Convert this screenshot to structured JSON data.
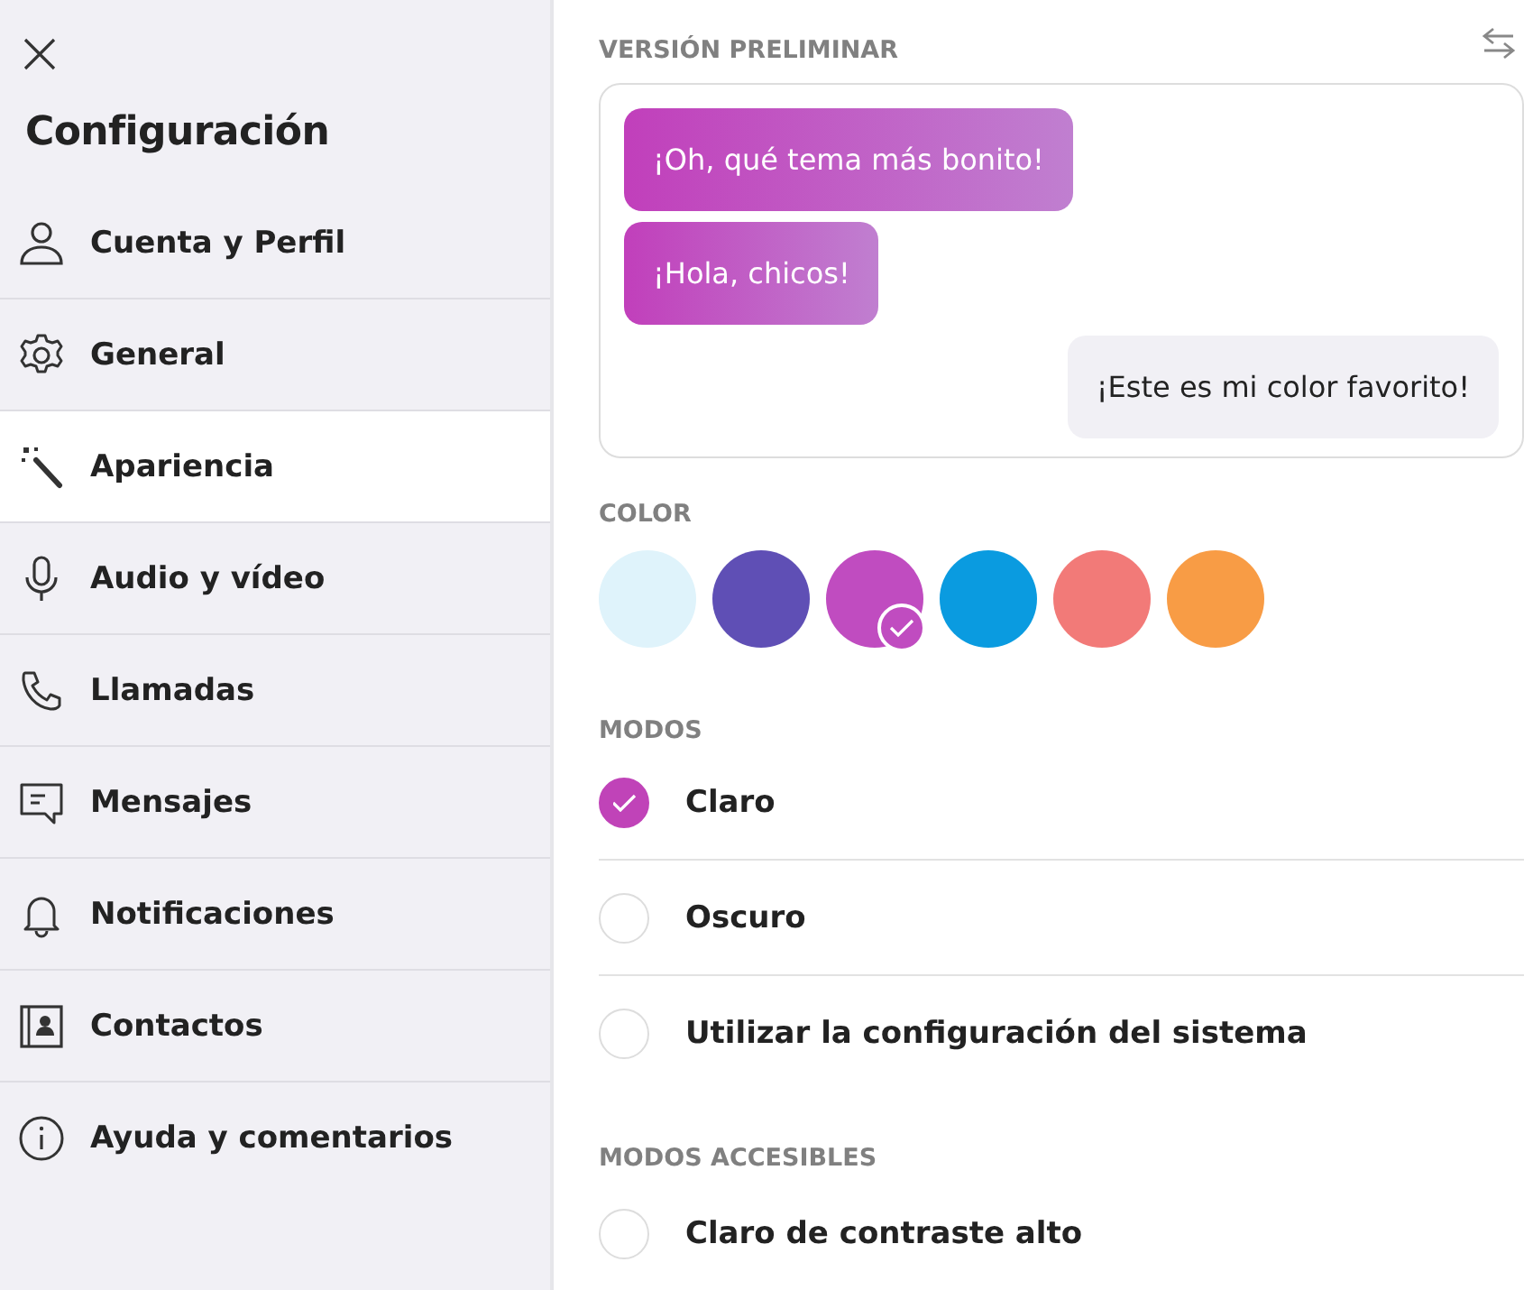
{
  "sidebar": {
    "title": "Configuración",
    "items": [
      {
        "label": "Cuenta y Perfil",
        "selected": false
      },
      {
        "label": "General",
        "selected": false
      },
      {
        "label": "Apariencia",
        "selected": true
      },
      {
        "label": "Audio y vídeo",
        "selected": false
      },
      {
        "label": "Llamadas",
        "selected": false
      },
      {
        "label": "Mensajes",
        "selected": false
      },
      {
        "label": "Notificaciones",
        "selected": false
      },
      {
        "label": "Contactos",
        "selected": false
      },
      {
        "label": "Ayuda y comentarios",
        "selected": false
      }
    ]
  },
  "preview": {
    "heading": "VERSIÓN PRELIMINAR",
    "messages": [
      {
        "text": "¡Oh, qué tema más bonito!",
        "kind": "incoming"
      },
      {
        "text": "¡Hola, chicos!",
        "kind": "incoming"
      },
      {
        "text": "¡Este es mi color favorito!",
        "kind": "outgoing"
      }
    ]
  },
  "color": {
    "heading": "COLOR",
    "swatches": [
      {
        "color": "#dff3fb",
        "selected": false
      },
      {
        "color": "#5f4fb5",
        "selected": false
      },
      {
        "color": "#c04cc0",
        "selected": true
      },
      {
        "color": "#0a9be0",
        "selected": false
      },
      {
        "color": "#f27a78",
        "selected": false
      },
      {
        "color": "#f89c45",
        "selected": false
      }
    ]
  },
  "modes": {
    "heading": "MODOS",
    "options": [
      {
        "label": "Claro",
        "selected": true
      },
      {
        "label": "Oscuro",
        "selected": false
      },
      {
        "label": "Utilizar la configuración del sistema",
        "selected": false
      }
    ]
  },
  "accessible_modes": {
    "heading": "MODOS ACCESIBLES",
    "options": [
      {
        "label": "Claro de contraste alto",
        "selected": false
      }
    ]
  }
}
